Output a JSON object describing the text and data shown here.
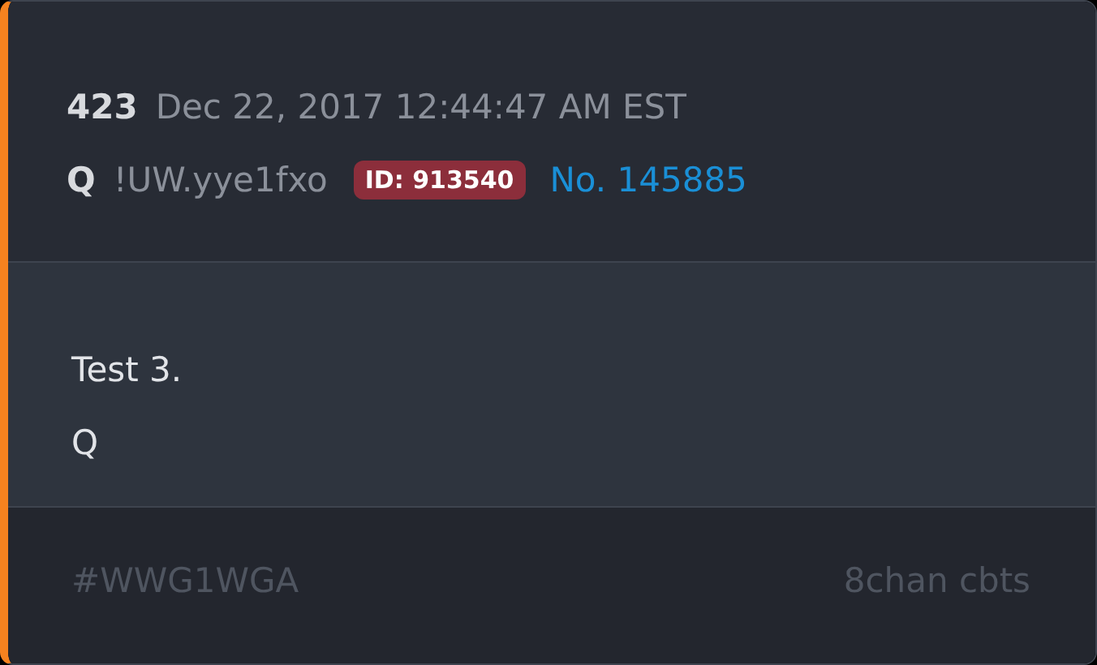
{
  "post": {
    "number": "423",
    "timestamp": "Dec 22, 2017 12:44:47 AM EST",
    "author": "Q",
    "tripcode": "!UW.yye1fxo",
    "id_badge": "ID: 913540",
    "post_link": "No. 145885"
  },
  "body": [
    "Test 3.",
    "Q"
  ],
  "footer": {
    "hashtag": "#WWG1WGA",
    "source": "8chan cbts"
  }
}
